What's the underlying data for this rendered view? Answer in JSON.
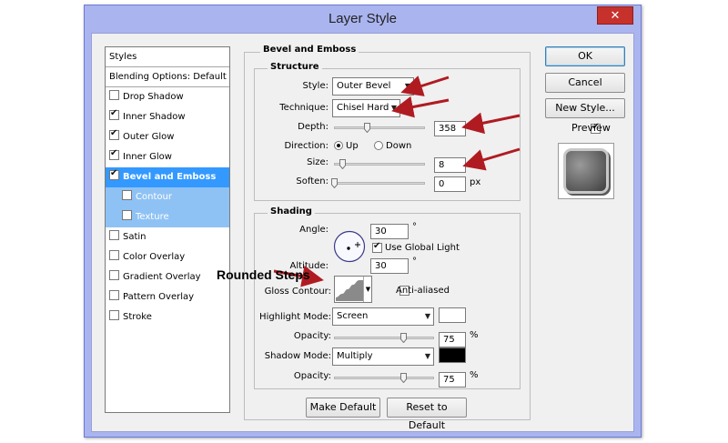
{
  "window": {
    "title": "Layer Style",
    "close_glyph": "✕"
  },
  "styles_panel": {
    "header": "Styles",
    "blending": "Blending Options: Default",
    "items": [
      {
        "label": "Drop Shadow",
        "checked": false
      },
      {
        "label": "Inner Shadow",
        "checked": true
      },
      {
        "label": "Outer Glow",
        "checked": true
      },
      {
        "label": "Inner Glow",
        "checked": true
      },
      {
        "label": "Bevel and Emboss",
        "checked": true,
        "selected": true
      },
      {
        "label": "Contour",
        "checked": false,
        "sub": true
      },
      {
        "label": "Texture",
        "checked": false,
        "sub": true
      },
      {
        "label": "Satin",
        "checked": false
      },
      {
        "label": "Color Overlay",
        "checked": false
      },
      {
        "label": "Gradient Overlay",
        "checked": false
      },
      {
        "label": "Pattern Overlay",
        "checked": false
      },
      {
        "label": "Stroke",
        "checked": false
      }
    ]
  },
  "bevel": {
    "title": "Bevel and Emboss",
    "structure": {
      "title": "Structure",
      "style_label": "Style:",
      "style_value": "Outer Bevel",
      "technique_label": "Technique:",
      "technique_value": "Chisel Hard",
      "depth_label": "Depth:",
      "depth_value": "358",
      "direction_label": "Direction:",
      "direction_up": "Up",
      "direction_down": "Down",
      "direction_selected": "Up",
      "size_label": "Size:",
      "size_value": "8",
      "soften_label": "Soften:",
      "soften_value": "0",
      "soften_unit": "px"
    },
    "shading": {
      "title": "Shading",
      "angle_label": "Angle:",
      "angle_value": "30",
      "degree": "°",
      "use_global_light": "Use Global Light",
      "use_global_light_checked": true,
      "altitude_label": "Altitude:",
      "altitude_value": "30",
      "gloss_contour_label": "Gloss Contour:",
      "anti_aliased": "Anti-aliased",
      "anti_aliased_checked": false,
      "highlight_mode_label": "Highlight Mode:",
      "highlight_mode_value": "Screen",
      "highlight_color": "#ffffff",
      "highlight_opacity_label": "Opacity:",
      "highlight_opacity_value": "75",
      "shadow_mode_label": "Shadow Mode:",
      "shadow_mode_value": "Multiply",
      "shadow_color": "#000000",
      "shadow_opacity_label": "Opacity:",
      "shadow_opacity_value": "75",
      "percent": "%"
    },
    "make_default": "Make Default",
    "reset_default": "Reset to Default"
  },
  "buttons": {
    "ok": "OK",
    "cancel": "Cancel",
    "new_style": "New Style...",
    "preview": "Preview",
    "preview_checked": true
  },
  "annotation": {
    "text": "Rounded Steps",
    "arrow_color": "#b01b22"
  },
  "colors": {
    "title_bar": "#aab4ef",
    "selected": "#3399ff",
    "sub_selected": "#8fc2f4",
    "close": "#c7312c"
  }
}
